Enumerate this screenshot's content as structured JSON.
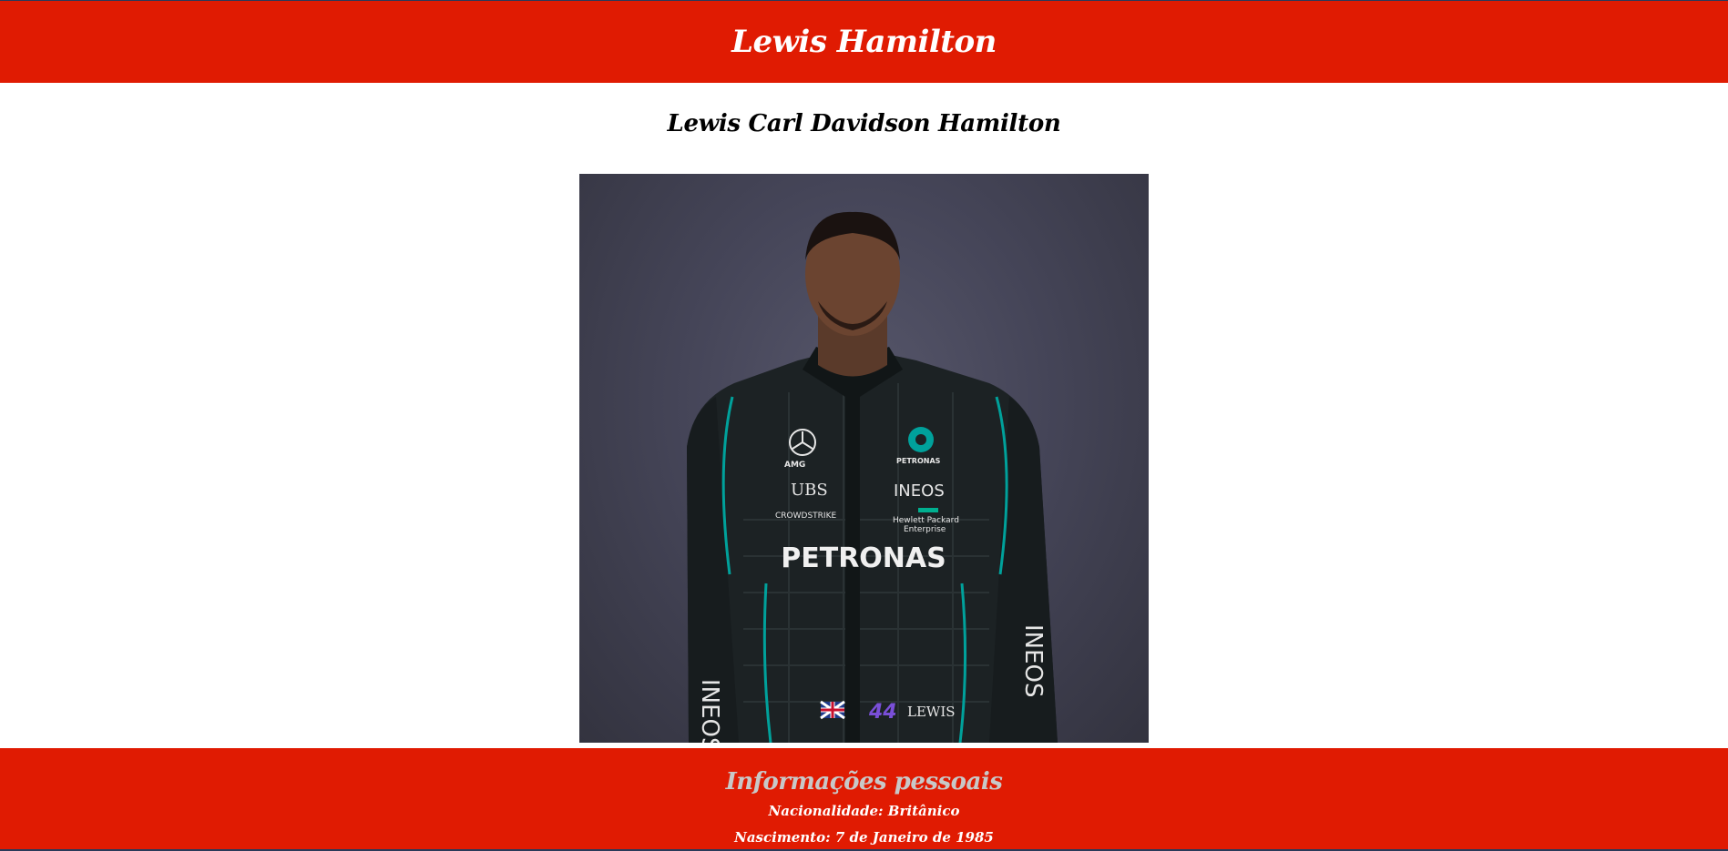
{
  "header": {
    "title": "Lewis Hamilton"
  },
  "main": {
    "subtitle": "Lewis Carl Davidson Hamilton",
    "photo": {
      "background_color": "#454558",
      "suit_color": "#1c2224",
      "accent_color": "#00a19b",
      "suit_texts": [
        "AMG",
        "UBS",
        "CROWDSTRIKE",
        "PETRONAS",
        "INEOS",
        "Hewlett Packard",
        "Enterprise",
        "PETRONAS",
        "INEOS",
        "INEOS",
        "44",
        "LEWIS"
      ]
    }
  },
  "footer": {
    "heading": "Informações pessoais",
    "nationality": "Nacionalidade: Britânico",
    "birth": "Nascimento: 7 de Janeiro de 1985"
  },
  "colors": {
    "brand_red": "#e01b02",
    "heading_grey": "#c8c8c8"
  }
}
